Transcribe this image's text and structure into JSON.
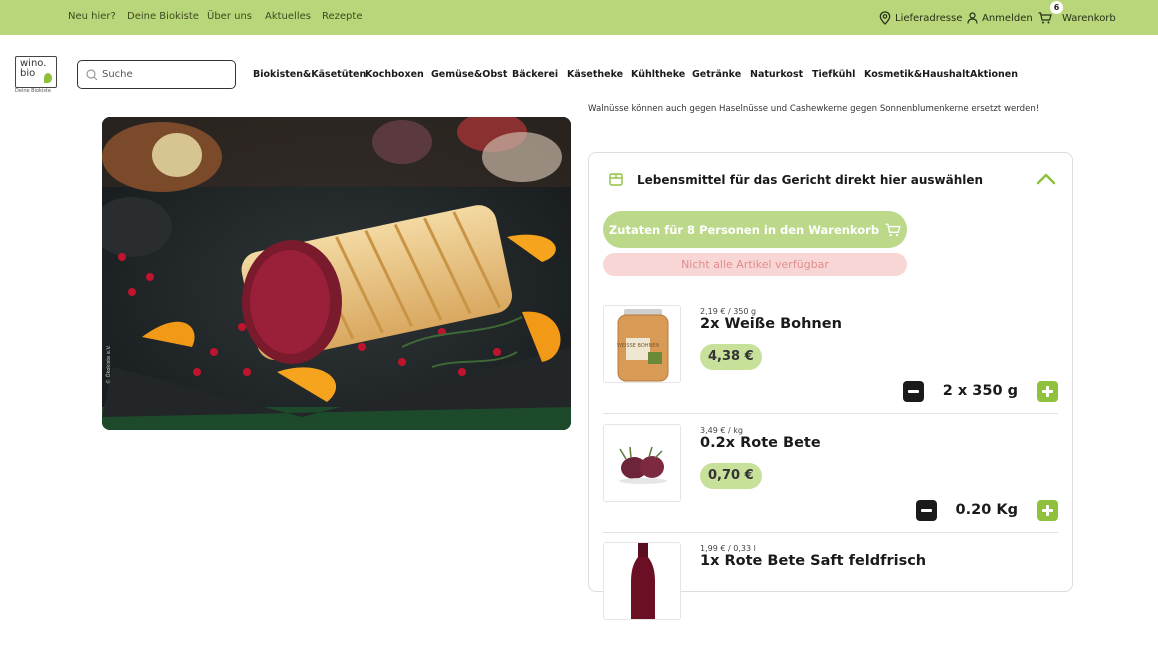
{
  "topnav": {
    "links": [
      "Neu hier?",
      "Deine Biokiste",
      "Über uns",
      "Aktuelles",
      "Rezepte"
    ],
    "delivery": "Lieferadresse",
    "login": "Anmelden",
    "cart_label": "Warenkorb",
    "cart_count": "6"
  },
  "logo": {
    "line1": "wino.",
    "line2": "bio",
    "tagline": "Deine Biokiste"
  },
  "search": {
    "placeholder": "Suche"
  },
  "mainnav": [
    "Biokisten&Käsetüten",
    "Kochboxen",
    "Gemüse&Obst",
    "Bäckerei",
    "Käsetheke",
    "Kühltheke",
    "Getränke",
    "Naturkost",
    "Tiefkühl",
    "Kosmetik&Haushalt",
    "Aktionen"
  ],
  "recipe": {
    "note": "Walnüsse können auch gegen Haselnüsse und Cashewkerne gegen Sonnenblumenkerne ersetzt werden!",
    "image_credit": "© Ökokiste e.V."
  },
  "panel": {
    "title": "Lebensmittel für das Gericht direkt hier auswählen",
    "add_button": "Zutaten für 8 Personen in den Warenkorb",
    "unavailable": "Nicht alle Artikel verfügbar"
  },
  "products": [
    {
      "unit_price": "2,19 € / 350 g",
      "name": "2x Weiße Bohnen",
      "price": "4,38 €",
      "qty": "2 x 350 g",
      "jar_label": "WEISSE BOHNEN"
    },
    {
      "unit_price": "3,49 € / kg",
      "name": "0.2x Rote Bete",
      "price": "0,70 €",
      "qty": "0.20 Kg"
    },
    {
      "unit_price": "1,99 € / 0,33 l",
      "name": "1x Rote Bete Saft feldfrisch"
    }
  ],
  "colors": {
    "accent_green": "#b9d67a",
    "price_pill": "#c7e09a",
    "plus_button": "#8fc13d",
    "warning_bg": "#f8d6d6"
  }
}
